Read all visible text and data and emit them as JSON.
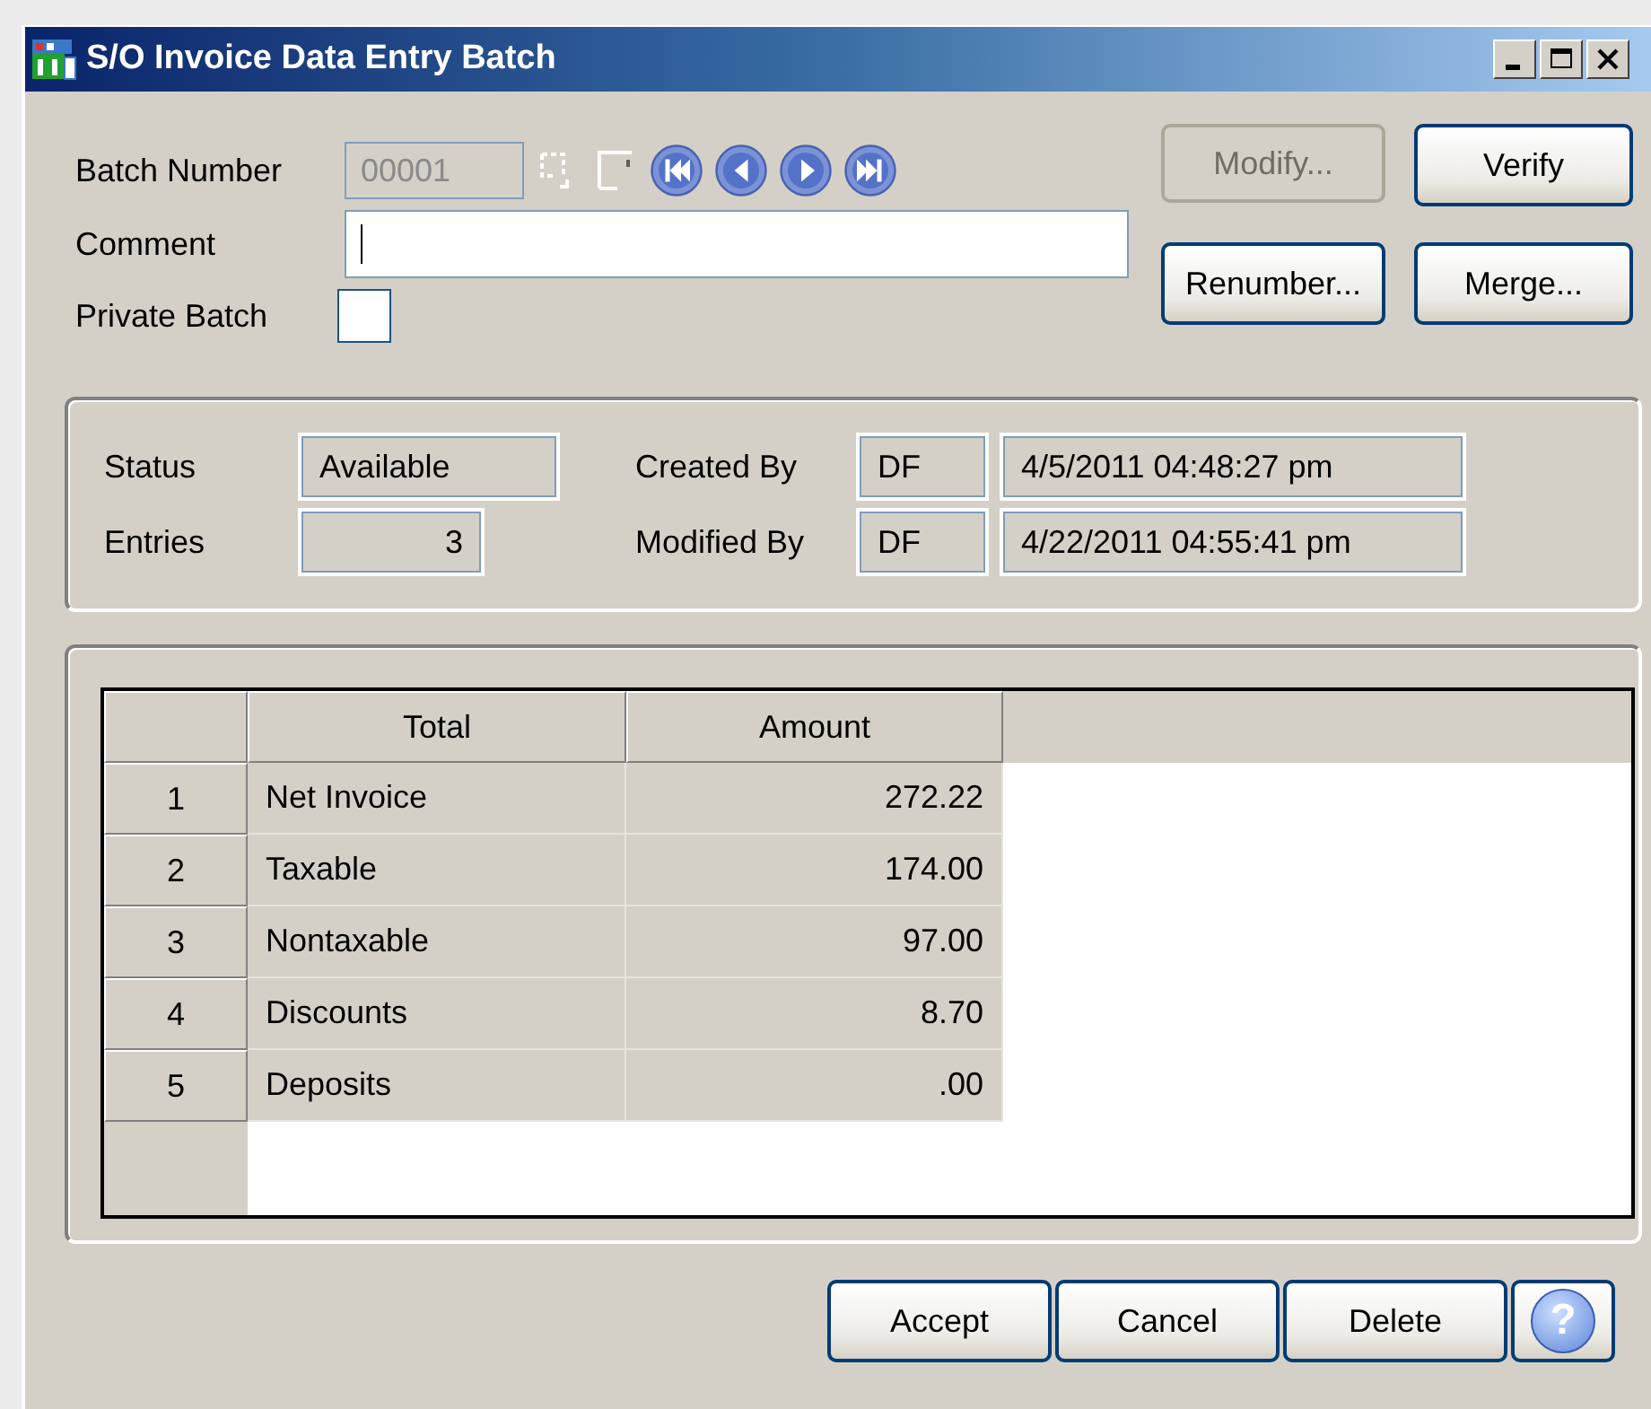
{
  "window": {
    "title": "S/O Invoice Data Entry Batch"
  },
  "header": {
    "batch_number": {
      "label": "Batch Number",
      "value": "00001",
      "disabled": true
    },
    "comment": {
      "label": "Comment"
    },
    "private_batch": {
      "label": "Private Batch",
      "checked": false
    }
  },
  "buttons": [
    {
      "label": "Modify...",
      "disabled": true
    },
    {
      "label": "Verify",
      "disabled": false
    },
    {
      "label": "Renumber...",
      "disabled": false
    },
    {
      "label": "Merge...",
      "disabled": false
    }
  ],
  "info": {
    "status": {
      "label": "Status",
      "value": "Available"
    },
    "entries": {
      "label": "Entries",
      "value": "3"
    },
    "created_by": {
      "label": "Created By",
      "user": "DF",
      "timestamp": "4/5/2011 04:48:27 pm"
    },
    "modified_by": {
      "label": "Modified By",
      "user": "DF",
      "timestamp": "4/22/2011 04:55:41 pm"
    }
  },
  "table": {
    "columns": [
      "Total",
      "Amount"
    ],
    "rows": [
      {
        "number": "1",
        "total": "Net Invoice",
        "amount": "272.22"
      },
      {
        "number": "2",
        "total": "Taxable",
        "amount": "174.00"
      },
      {
        "number": "3",
        "total": "Nontaxable",
        "amount": "97.00"
      },
      {
        "number": "4",
        "total": "Discounts",
        "amount": "8.70"
      },
      {
        "number": "5",
        "total": "Deposits",
        "amount": ".00"
      }
    ]
  },
  "footer_buttons": [
    {
      "kind": "text",
      "label": "Accept"
    },
    {
      "kind": "text",
      "label": "Cancel"
    },
    {
      "kind": "text",
      "label": "Delete"
    },
    {
      "kind": "help",
      "label": "?"
    }
  ]
}
